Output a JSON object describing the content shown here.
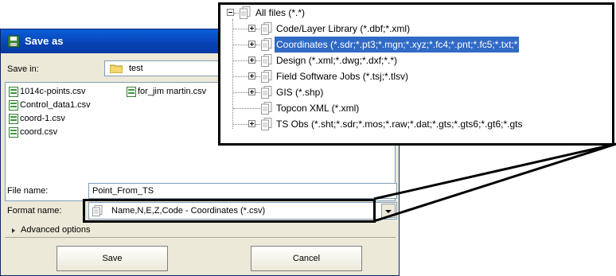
{
  "dialog": {
    "title": "Save as",
    "save_in_label": "Save in:",
    "save_in_value": "test",
    "files": [
      {
        "name": "1014c-points.csv"
      },
      {
        "name": "for_jim martin.csv"
      },
      {
        "name": "Control_data1.csv"
      },
      {
        "name": "coord-1.csv"
      },
      {
        "name": "coord.csv"
      }
    ],
    "file_name_label": "File name:",
    "file_name_value": "Point_From_TS",
    "format_name_label": "Format name:",
    "format_name_value": "Name,N,E,Z,Code - Coordinates (*.csv)",
    "advanced_label": "Advanced options",
    "save_button": "Save",
    "cancel_button": "Cancel"
  },
  "tree": {
    "root": "All files (*.*)",
    "items": [
      {
        "label": "Code/Layer Library (*.dbf;*.xml)",
        "expandable": true,
        "selected": false
      },
      {
        "label": "Coordinates (*.sdr;*.pt3;*.mgn;*.xyz;*.fc4;*.pnt;*.fc5;*.txt;*",
        "expandable": true,
        "selected": true
      },
      {
        "label": "Design (*.xml;*.dwg;*.dxf;*.*)",
        "expandable": true,
        "selected": false
      },
      {
        "label": "Field Software Jobs (*.tsj;*.tlsv)",
        "expandable": true,
        "selected": false
      },
      {
        "label": "GIS (*.shp)",
        "expandable": true,
        "selected": false
      },
      {
        "label": "Topcon XML (*.xml)",
        "expandable": false,
        "selected": false
      },
      {
        "label": "TS Obs (*.sht;*.sdr;*.mos;*.raw;*.dat;*.gts;*.gts6;*.gt6;*.gts",
        "expandable": true,
        "selected": false
      }
    ]
  },
  "colors": {
    "title_bar": "#0842b5",
    "selection": "#316ac5",
    "dialog_bg": "#ece9d8"
  }
}
